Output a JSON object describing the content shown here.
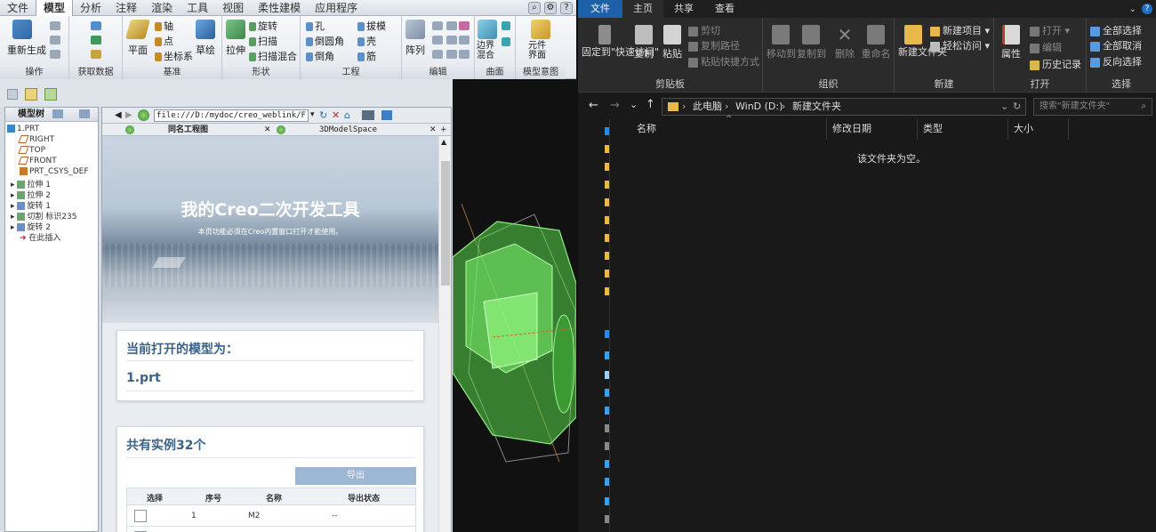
{
  "creo": {
    "menu": [
      "文件",
      "模型",
      "分析",
      "注释",
      "渲染",
      "工具",
      "视图",
      "柔性建模",
      "应用程序"
    ],
    "menu_active": 1,
    "ribbon": {
      "regen": "重新生成",
      "groups": [
        "操作",
        "获取数据",
        "基准",
        "形状",
        "工程",
        "编辑",
        "曲面",
        "模型意图"
      ],
      "items": {
        "plane": "平面",
        "axis": "轴",
        "point": "点",
        "csys": "坐标系",
        "sketch": "草绘",
        "extrude": "拉伸",
        "revolve": "旋转",
        "sweep": "扫描",
        "swept_blend": "扫描混合",
        "hole": "孔",
        "round": "倒圆角",
        "chamfer": "倒角",
        "draft": "拔模",
        "shell": "壳",
        "rib": "筋",
        "pattern": "阵列",
        "boundary_blend": "边界混合",
        "component_interface": "元件界面"
      }
    },
    "model_tree": {
      "header": "模型树",
      "items": [
        "1.PRT",
        "RIGHT",
        "TOP",
        "FRONT",
        "PRT_CSYS_DEF",
        "拉伸 1",
        "拉伸 2",
        "旋转 1",
        "切割 标识235",
        "旋转 2",
        "在此插入"
      ]
    },
    "browser": {
      "address": "file:///D:/mydoc/creo_weblink/F",
      "tabs": [
        "同名工程图",
        "3DModelSpace"
      ],
      "hero_title": "我的Creo二次开发工具",
      "hero_subtitle": "本页功能必须在Creo内置窗口打开才能使用。",
      "card1_title": "当前打开的模型为：",
      "card1_value": "1.prt",
      "card2_title": "共有实例32个",
      "export_button": "导出",
      "table_headers": [
        "选择",
        "序号",
        "名称",
        "导出状态"
      ],
      "table_rows": [
        {
          "index": "1",
          "name": "M2",
          "status": "--"
        }
      ]
    }
  },
  "explorer": {
    "tabs": [
      "文件",
      "主页",
      "共享",
      "查看"
    ],
    "active_tab": 1,
    "ribbon": {
      "clipboard": {
        "label": "剪贴板",
        "pin": "固定到\"快速访问\"",
        "copy": "复制",
        "paste": "粘贴",
        "cut": "剪切",
        "copy_path": "复制路径",
        "paste_shortcut": "粘贴快捷方式"
      },
      "organize": {
        "label": "组织",
        "move_to": "移动到",
        "copy_to": "复制到",
        "delete": "删除",
        "rename": "重命名"
      },
      "new": {
        "label": "新建",
        "new_folder": "新建文件夹",
        "new_item": "新建项目",
        "easy_access": "轻松访问"
      },
      "open": {
        "label": "打开",
        "properties": "属性",
        "open": "打开",
        "edit": "编辑",
        "history": "历史记录"
      },
      "select": {
        "label": "选择",
        "select_all": "全部选择",
        "select_none": "全部取消",
        "invert": "反向选择"
      }
    },
    "path": [
      "此电脑",
      "WinD (D:)",
      "新建文件夹"
    ],
    "search_placeholder": "搜索\"新建文件夹\"",
    "columns": [
      "名称",
      "修改日期",
      "类型",
      "大小"
    ],
    "empty_text": "该文件夹为空。"
  },
  "colors": {
    "creo_accent": "#3c6289",
    "explorer_file_tab": "#1d5fa8",
    "model_green": "#57d84d"
  }
}
